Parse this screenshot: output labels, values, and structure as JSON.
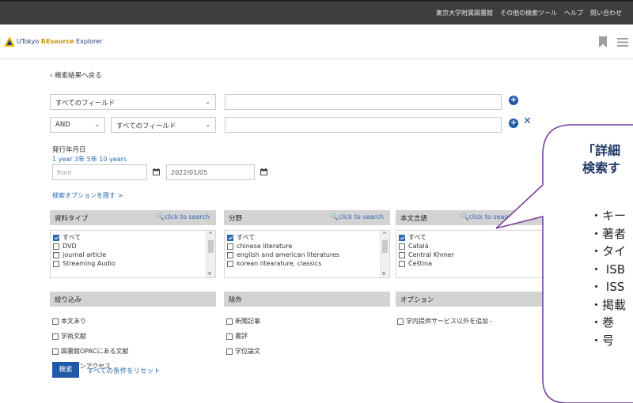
{
  "topbar": {
    "links": [
      "東京大学附属図書館",
      "その他の検索ツール",
      "ヘルプ",
      "問い合わせ"
    ]
  },
  "brand": {
    "prefix": "UTokyo ",
    "highlight": "REsource",
    "suffix": " Explorer"
  },
  "back_link": "‹ 検索結果へ戻る",
  "search_rows": [
    {
      "field": "すべてのフィールド",
      "value": ""
    },
    {
      "operator": "AND",
      "field": "すべてのフィールド",
      "value": ""
    }
  ],
  "date": {
    "label": "発行年月日",
    "quick": "1 year 3年 5年 10 years",
    "from_placeholder": "from",
    "to_value": "2022/01/05"
  },
  "options_toggle": "検索オプションを隠す >",
  "panels": [
    {
      "title": "資料タイプ",
      "click_search": "click to search",
      "items": [
        {
          "label": "すべて",
          "checked": true
        },
        {
          "label": "DVD",
          "checked": false
        },
        {
          "label": "journal article",
          "checked": false
        },
        {
          "label": "Streaming Audio",
          "checked": false
        }
      ]
    },
    {
      "title": "分野",
      "click_search": "click to search",
      "items": [
        {
          "label": "すべて",
          "checked": true
        },
        {
          "label": "chinese literature",
          "checked": false
        },
        {
          "label": "english and american literatures",
          "checked": false
        },
        {
          "label": "korean litearature, classics",
          "checked": false
        }
      ]
    },
    {
      "title": "本文言語",
      "click_search": "click to search",
      "items": [
        {
          "label": "すべて",
          "checked": true
        },
        {
          "label": "Català",
          "checked": false
        },
        {
          "label": "Central Khmer",
          "checked": false
        },
        {
          "label": "Čeština",
          "checked": false
        }
      ]
    }
  ],
  "filters": {
    "narrow": {
      "title": "絞り込み",
      "items": [
        "本文あり",
        "学術文献",
        "図書館OPACにある文献",
        "オープンアクセス"
      ]
    },
    "exclude": {
      "title": "除外",
      "items": [
        "新聞記事",
        "書評",
        "学位論文"
      ]
    },
    "option": {
      "title": "オプション",
      "items": [
        "学内提供サービス以外を追加 -"
      ]
    }
  },
  "buttons": {
    "search": "検索",
    "reset": "すべての条件をリセット"
  },
  "callout": {
    "heading_line1": "「詳細",
    "heading_line2": "検索す",
    "items": [
      "・キー",
      "・著者",
      "・タイ",
      "・ ISB",
      "・ ISS",
      "・掲載",
      "・巻",
      "・号"
    ]
  },
  "colors": {
    "accent": "#1f5aa6",
    "topbar": "#3e3e3e",
    "panel_header": "#d3d3d3",
    "callout_title": "#1f3864"
  }
}
